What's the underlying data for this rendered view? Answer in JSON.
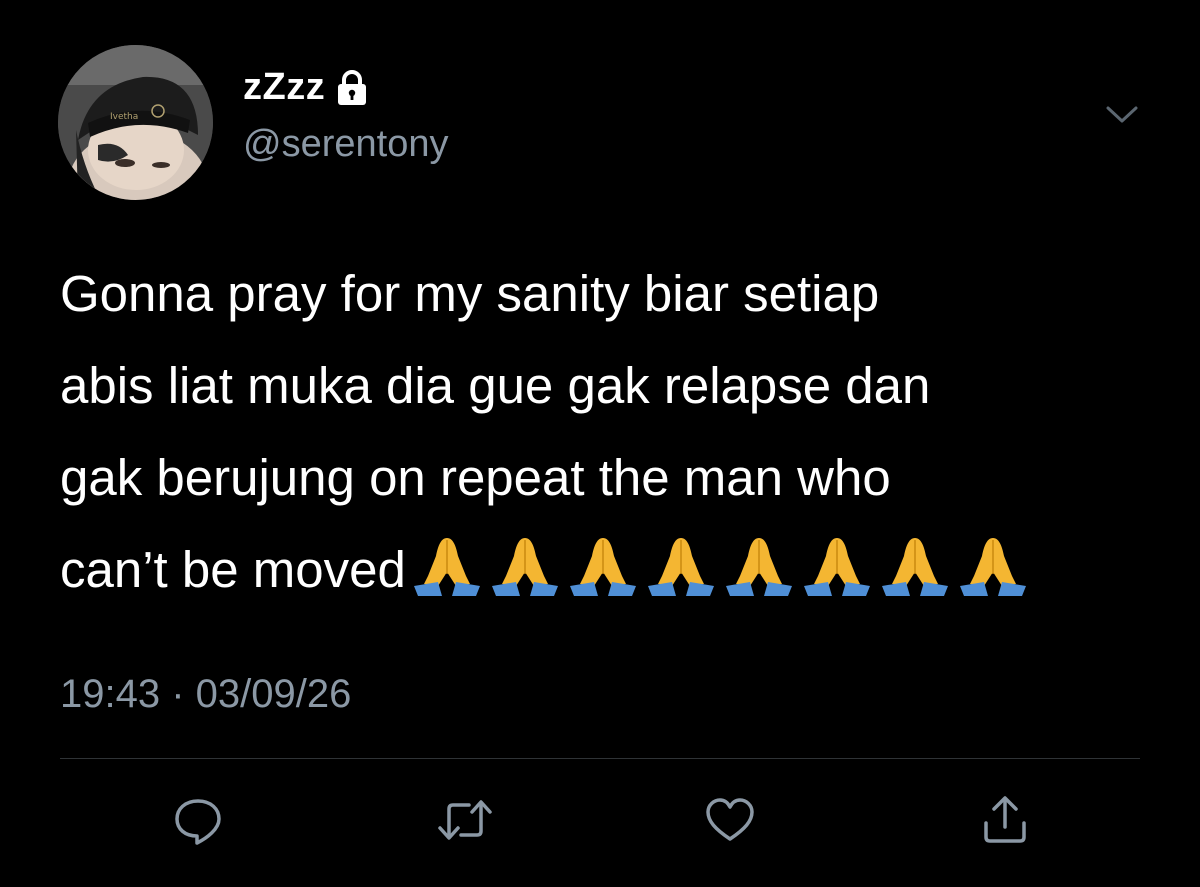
{
  "user": {
    "display_name": "zZzz",
    "handle": "@serentony",
    "protected_icon": "lock-icon",
    "avatar_icon": "profile-photo"
  },
  "tweet": {
    "lines": [
      "Gonna pray for my sanity biar setiap",
      "abis liat muka dia gue gak relapse dan",
      "gak berujung on repeat the man who",
      "can’t be moved"
    ],
    "emoji": "🙏",
    "emoji_count": 8,
    "timestamp": "19:43 · 03/09/26"
  },
  "menu": {
    "caret_icon": "chevron-down-icon"
  },
  "actions": {
    "icons": [
      "reply-icon",
      "retweet-icon",
      "like-icon",
      "share-icon"
    ]
  },
  "colors": {
    "background": "#000000",
    "text_primary": "#ffffff",
    "text_secondary": "#8b98a5",
    "divider": "#2f3336",
    "emoji_hands": "#f4b632",
    "emoji_sleeves": "#4f8fd6"
  }
}
